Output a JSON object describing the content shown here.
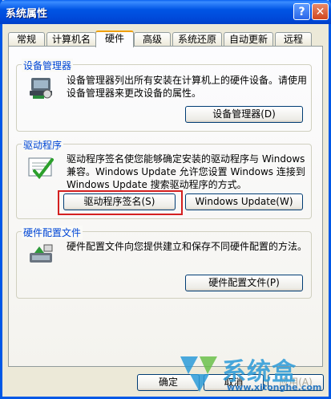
{
  "window": {
    "title": "系统属性",
    "help_label": "?",
    "close_label": "✕"
  },
  "tabs": [
    {
      "label": "常规"
    },
    {
      "label": "计算机名"
    },
    {
      "label": "硬件",
      "active": true
    },
    {
      "label": "高级"
    },
    {
      "label": "系统还原"
    },
    {
      "label": "自动更新"
    },
    {
      "label": "远程"
    }
  ],
  "device_manager": {
    "group_label": "设备管理器",
    "description": "设备管理器列出所有安装在计算机上的硬件设备。请使用设备管理器来更改设备的属性。",
    "button_label": "设备管理器(D)",
    "icon": "device-manager-icon"
  },
  "drivers": {
    "group_label": "驱动程序",
    "description": "驱动程序签名使您能够确定安装的驱动程序与 Windows 兼容。Windows Update 允许您设置 Windows 连接到 Windows Update 搜索驱动程序的方式。",
    "signing_button_label": "驱动程序签名(S)",
    "update_button_label": "Windows Update(W)",
    "icon": "driver-signing-icon"
  },
  "hardware_profiles": {
    "group_label": "硬件配置文件",
    "description": "硬件配置文件向您提供建立和保存不同硬件配置的方法。",
    "button_label": "硬件配置文件(P)",
    "icon": "hardware-profile-icon"
  },
  "footer": {
    "ok_label": "确定",
    "cancel_label": "取消",
    "apply_label": "应用(A)"
  },
  "watermark": {
    "brand": "系统盒",
    "url": "www.xitonghe.com"
  },
  "colors": {
    "titlebar": "#0055e5",
    "group_label": "#0046d5",
    "highlight": "#d42020"
  }
}
